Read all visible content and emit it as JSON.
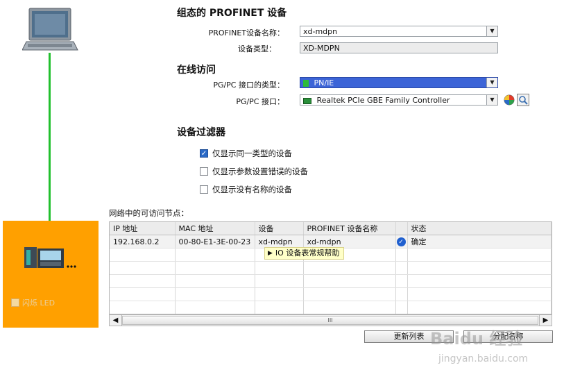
{
  "config_section": {
    "heading": "组态的 PROFINET 设备",
    "device_name_label": "PROFINET设备名称：",
    "device_name_value": "xd-mdpn",
    "device_type_label": "设备类型：",
    "device_type_value": "XD-MDPN"
  },
  "online_section": {
    "heading": "在线访问",
    "pgpc_type_label": "PG/PC 接口的类型：",
    "pgpc_type_value": "PN/IE",
    "pgpc_interface_label": "PG/PC 接口：",
    "pgpc_interface_value": "Realtek PCIe GBE Family Controller"
  },
  "filter_section": {
    "heading": "设备过滤器",
    "filters": [
      {
        "label": "仅显示同一类型的设备",
        "checked": true
      },
      {
        "label": "仅显示参数设置错误的设备",
        "checked": false
      },
      {
        "label": "仅显示没有名称的设备",
        "checked": false
      }
    ]
  },
  "nodes_section": {
    "title": "网络中的可访问节点：",
    "columns": [
      "IP 地址",
      "MAC 地址",
      "设备",
      "PROFINET 设备名称",
      "",
      "状态"
    ],
    "rows": [
      {
        "ip": "192.168.0.2",
        "mac": "00-80-E1-3E-00-23",
        "device": "xd-mdpn",
        "profinet_name": "xd-mdpn",
        "status": "确定"
      }
    ],
    "tooltip": "IO 设备表常规帮助",
    "scroll_mid": "III"
  },
  "buttons": {
    "refresh": "更新列表",
    "assign": "分配名称"
  },
  "device_panel": {
    "flash_led_label": "闪烁 LED"
  },
  "watermark": {
    "brand": "Baidu 经验",
    "url": "jingyan.baidu.com"
  },
  "colors": {
    "orange": "#ffa000",
    "network_line": "#22c02e",
    "selection": "#3c64d7"
  }
}
